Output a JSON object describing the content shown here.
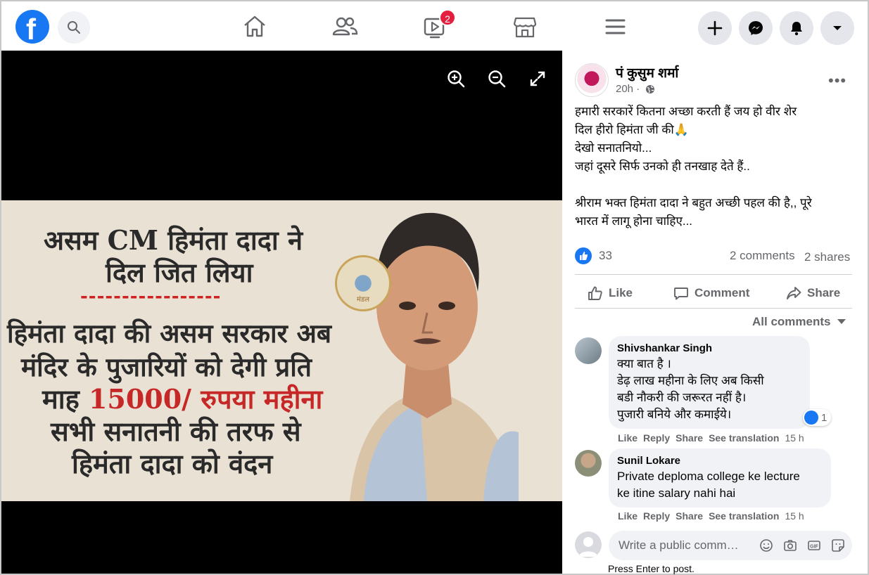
{
  "nav": {
    "logo_letter": "f",
    "watch_badge": "2"
  },
  "poster": {
    "line1": "असम CM हिमंता दादा ने",
    "line2": "दिल जित लिया",
    "dashes": "-----------------",
    "line3": "हिमंता दादा की असम सरकार अब",
    "line4": "मंदिर के पुजारियों को देगी प्रति",
    "line5_a": "माह ",
    "line5_b": "15000/ रुपया महीना",
    "line6": "सभी सनातनी की तरफ से",
    "line7": "हिमंता दादा को वंदन",
    "seal_text": "मंडल"
  },
  "post": {
    "author": "पं कुसुम शर्मा",
    "time": "20h ·",
    "more": "•••",
    "text": [
      "हमारी सरकारें कितना अच्छा करती हैं जय हो वीर शेर",
      "दिल हीरो हिमंता जी की🙏",
      "देखो सनातनियो...",
      "जहां दूसरे सिर्फ उनको ही तनखाह देते हैं..",
      "",
      "श्रीराम भक्त हिमंता दादा ने बहुत अच्छी पहल की है,, पूरे",
      "भारत में लागू होना चाहिए..."
    ],
    "likes": "33",
    "comments": "2 comments",
    "shares": "2 shares"
  },
  "actions": {
    "like": "Like",
    "comment": "Comment",
    "share": "Share"
  },
  "all_comments": "All comments",
  "comments": [
    {
      "name": "Shivshankar Singh",
      "lines": [
        "क्या बात है ।",
        "डेढ़ लाख महीना के लिए अब किसी",
        "बडी नौकरी की जरूरत नहीं है।",
        "पुजारी बनिये और कमाईये।"
      ],
      "reactions": "1",
      "like": "Like",
      "reply": "Reply",
      "share": "Share",
      "translate": "See translation",
      "time": "15 h"
    },
    {
      "name": "Sunil Lokare",
      "lines": [
        "Private deploma college ke lecture",
        "ke itine salary nahi hai"
      ],
      "like": "Like",
      "reply": "Reply",
      "share": "Share",
      "translate": "See translation",
      "time": "15 h"
    }
  ],
  "composer": {
    "placeholder": "Write a public comm…",
    "hint": "Press Enter to post."
  },
  "colors": {
    "brand": "#1877f2",
    "badge": "#e41e3f",
    "poster_highlight": "#c62828"
  }
}
